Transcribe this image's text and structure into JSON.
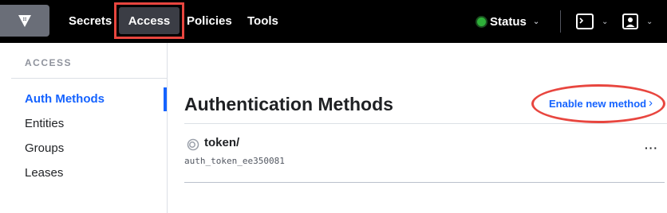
{
  "topnav": {
    "logo_icon": "vault-logo-icon",
    "items": [
      "Secrets",
      "Access",
      "Policies",
      "Tools"
    ],
    "active": "Access",
    "status_label": "Status",
    "status_color": "#2eb039",
    "console_icon": "terminal-icon",
    "user_icon": "user-icon"
  },
  "sidebar": {
    "section_title": "ACCESS",
    "items": [
      "Auth Methods",
      "Entities",
      "Groups",
      "Leases"
    ],
    "active": "Auth Methods"
  },
  "main": {
    "title": "Authentication Methods",
    "enable_link": "Enable new method",
    "methods": [
      {
        "path": "token/",
        "accessor": "auth_token_ee350081",
        "icon": "token-icon"
      }
    ]
  },
  "colors": {
    "accent": "#1563ff",
    "annotation": "#e8463f",
    "nav_bg": "#000000"
  }
}
